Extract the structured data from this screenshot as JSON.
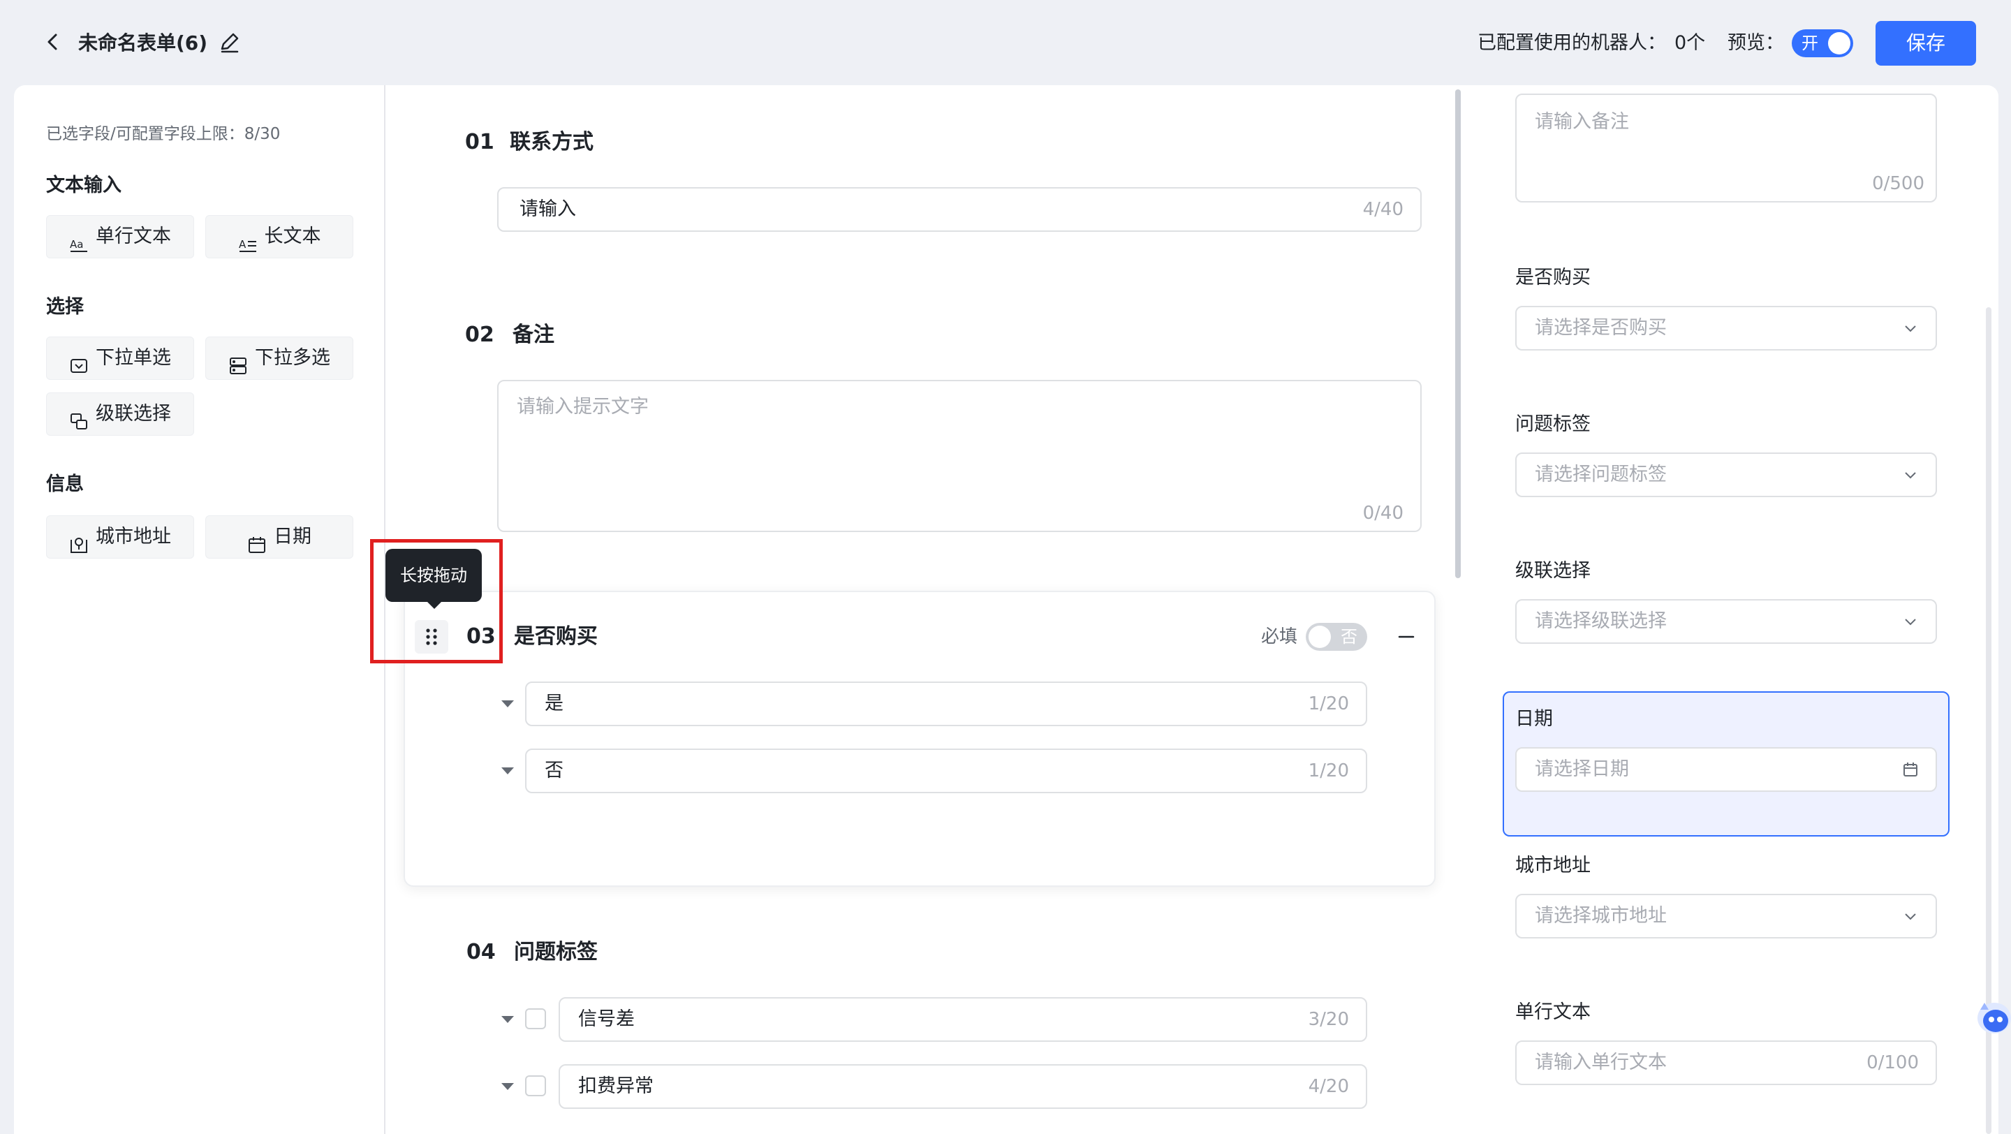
{
  "header": {
    "title": "未命名表单(6)",
    "robot_label": "已配置使用的机器人：",
    "robot_count": "0个",
    "preview_label": "预览：",
    "preview_toggle": "开",
    "save_label": "保存"
  },
  "sidebar": {
    "limit_text": "已选字段/可配置字段上限：8/30",
    "groups": [
      {
        "title": "文本输入",
        "items": [
          "单行文本",
          "长文本"
        ]
      },
      {
        "title": "选择",
        "items": [
          "下拉单选",
          "下拉多选",
          "级联选择"
        ]
      },
      {
        "title": "信息",
        "items": [
          "城市地址",
          "日期"
        ]
      }
    ]
  },
  "editor": {
    "tooltip": "长按拖动",
    "sections": [
      {
        "num": "01",
        "title": "联系方式",
        "input_value": "请输入",
        "count": "4/40"
      },
      {
        "num": "02",
        "title": "备注",
        "placeholder": "请输入提示文字",
        "count": "0/40"
      },
      {
        "num": "03",
        "title": "是否购买",
        "required_label": "必填",
        "required_toggle": "否",
        "options": [
          {
            "value": "是",
            "count": "1/20"
          },
          {
            "value": "否",
            "count": "1/20"
          }
        ]
      },
      {
        "num": "04",
        "title": "问题标签",
        "options": [
          {
            "value": "信号差",
            "count": "3/20"
          },
          {
            "value": "扣费异常",
            "count": "4/20"
          }
        ]
      }
    ]
  },
  "preview": {
    "remark_placeholder": "请输入备注",
    "remark_count": "0/500",
    "fields": [
      {
        "label": "是否购买",
        "placeholder": "请选择是否购买"
      },
      {
        "label": "问题标签",
        "placeholder": "请选择问题标签"
      },
      {
        "label": "级联选择",
        "placeholder": "请选择级联选择"
      },
      {
        "label": "日期",
        "placeholder": "请选择日期"
      },
      {
        "label": "城市地址",
        "placeholder": "请选择城市地址"
      },
      {
        "label": "单行文本",
        "placeholder": "请输入单行文本",
        "count": "0/100"
      }
    ]
  },
  "colors": {
    "accent": "#3370ff",
    "highlight": "#e02020",
    "tooltip_bg": "#1f2329"
  }
}
